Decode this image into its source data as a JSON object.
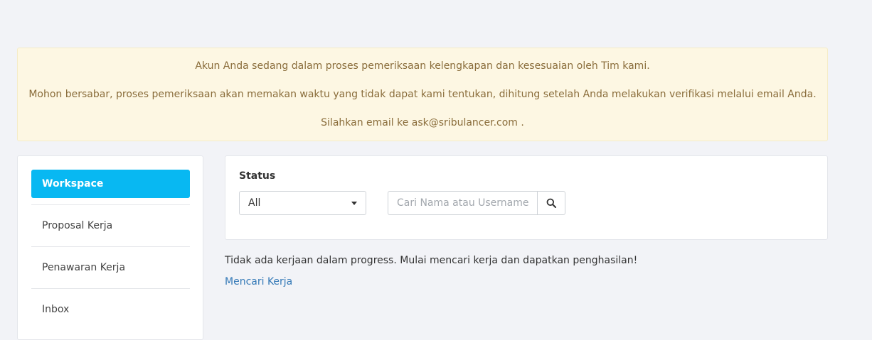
{
  "notice": {
    "line1": "Akun Anda sedang dalam proses pemeriksaan kelengkapan dan kesesuaian oleh Tim kami.",
    "line2": "Mohon bersabar, proses pemeriksaan akan memakan waktu yang tidak dapat kami tentukan, dihitung setelah Anda melakukan verifikasi melalui email Anda.",
    "line3": "Silahkan email ke ask@sribulancer.com ."
  },
  "sidebar": {
    "items": [
      {
        "label": "Workspace",
        "active": true
      },
      {
        "label": "Proposal Kerja"
      },
      {
        "label": "Penawaran Kerja"
      },
      {
        "label": "Inbox"
      }
    ]
  },
  "filter": {
    "status_label": "Status",
    "status_value": "All",
    "search_placeholder": "Cari Nama atau Username",
    "search_icon": "search-icon"
  },
  "main": {
    "empty_message": "Tidak ada kerjaan dalam progress. Mulai mencari kerja dan dapatkan penghasilan!",
    "find_work_link": "Mencari Kerja"
  },
  "colors": {
    "accent": "#08b8f2",
    "link": "#3479b7",
    "notice_bg": "#fdf7e3",
    "notice_text": "#8a6d3b"
  }
}
